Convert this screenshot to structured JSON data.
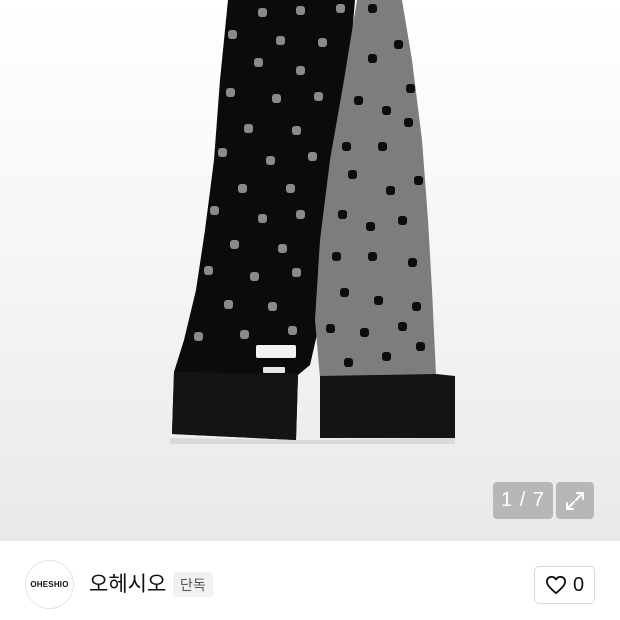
{
  "gallery": {
    "counter": "1 / 7",
    "expand_icon": "expand-arrows-icon",
    "image": {
      "subject": "knit scarf with polka dots",
      "colors": {
        "black": "#0b0b0b",
        "grey": "#7d7d7d",
        "dot_light": "#8a8a8a",
        "dot_dark": "#0d0d0d"
      }
    }
  },
  "seller": {
    "logo_text": "OHESHIO",
    "name": "오헤시오",
    "badge": "단독"
  },
  "like": {
    "icon": "heart-outline-icon",
    "count": "0"
  }
}
